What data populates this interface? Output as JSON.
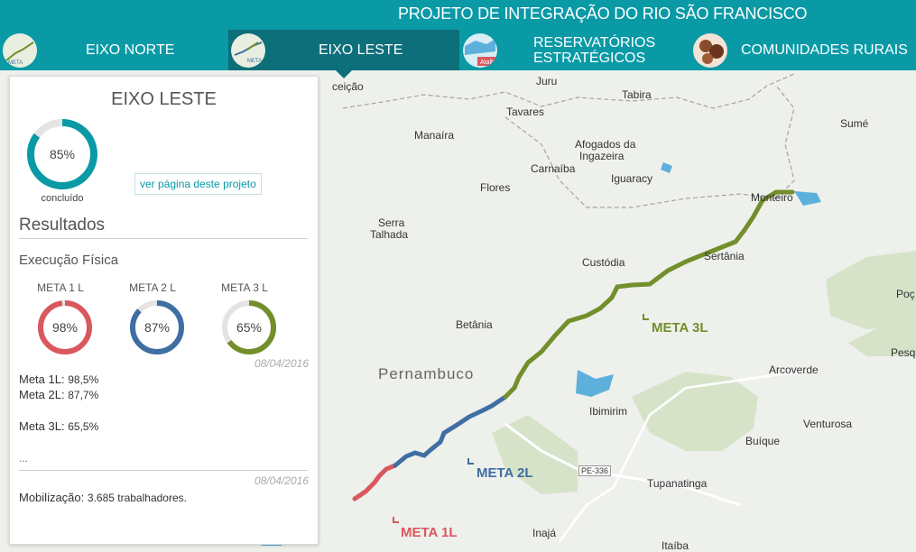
{
  "header": {
    "title": "PROJETO DE INTEGRAÇÃO DO RIO SÃO FRANCISCO"
  },
  "nav": {
    "tabs": [
      {
        "label": "EIXO NORTE"
      },
      {
        "label": "EIXO LESTE"
      },
      {
        "label_line1": "RESERVATÓRIOS",
        "label_line2": "ESTRATÉGICOS",
        "thumb_text": "Atalh"
      },
      {
        "label": "COMUNIDADES RURAIS"
      }
    ],
    "thumb_north_text": "META",
    "thumb_east_text": "META"
  },
  "panel": {
    "title": "EIXO LESTE",
    "overall_percent": "85%",
    "overall_progress": 0.85,
    "overall_caption": "concluído",
    "project_link": "ver página deste projeto",
    "results_heading": "Resultados",
    "physical_heading": "Execução Física",
    "metas": [
      {
        "label": "META 1 L",
        "percent": "98%",
        "progress": 0.98,
        "color": "#d9585d"
      },
      {
        "label": "META 2 L",
        "percent": "87%",
        "progress": 0.87,
        "color": "#3f6ea3"
      },
      {
        "label": "META 3 L",
        "percent": "65%",
        "progress": 0.65,
        "color": "#728f2b"
      }
    ],
    "date1": "08/04/2016",
    "meta_lines": [
      {
        "label": "Meta 1L:",
        "value": "98,5%"
      },
      {
        "label": "Meta 2L:",
        "value": "87,7%"
      },
      {
        "label": "Meta 3L:",
        "value": "65,5%"
      }
    ],
    "ellipsis": "...",
    "date2": "08/04/2016",
    "mobilization_label": "Mobilização:",
    "mobilization_value": "3.685 trabalhadores."
  },
  "map": {
    "colors": {
      "meta1": "#d9585d",
      "meta2": "#3f6ea3",
      "meta3": "#728f2b",
      "water": "#5eb0dc",
      "green": "#d6e3c9"
    },
    "labels": {
      "conceicao": "ceição",
      "juru": "Juru",
      "tabira": "Tabira",
      "tavares": "Tavares",
      "sume": "Sumé",
      "manaira": "Manaíra",
      "afogados1": "Afogados da",
      "afogados2": "Ingazeira",
      "carnaiba": "Carnaíba",
      "iguaracy": "Iguaracy",
      "flores": "Flores",
      "monteiro": "Monteiro",
      "serra1": "Serra",
      "serra2": "Talhada",
      "custodia": "Custódia",
      "sertania": "Sertânia",
      "poc": "Poç",
      "betania": "Betânia",
      "pesqu": "Pesqu",
      "pernambuco": "Pernambuco",
      "arcoverde": "Arcoverde",
      "ibimirim": "Ibimirim",
      "venturosa": "Venturosa",
      "buique": "Buíque",
      "pe336": "PE-336",
      "tupanatinga": "Tupanatinga",
      "inaja": "Inajá",
      "itaiba": "Itaíba",
      "meta3l": "META 3L",
      "meta2l": "META 2L",
      "meta1l": "META 1L"
    }
  }
}
